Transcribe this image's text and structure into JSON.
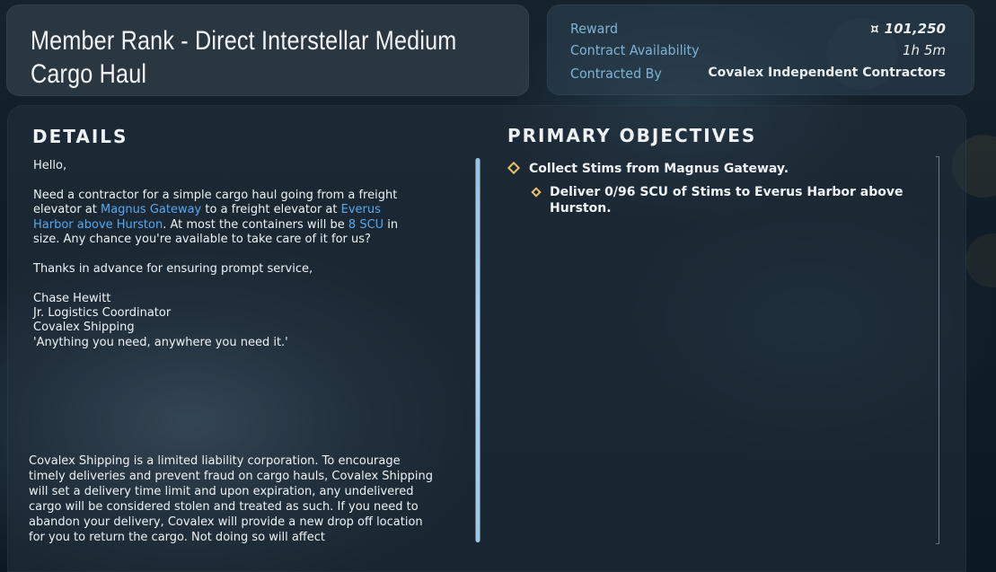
{
  "contract": {
    "title_line1": "Member Rank - Direct Interstellar Medium",
    "title_line2": "Cargo Haul"
  },
  "summary": {
    "reward_label": "Reward",
    "reward_icon": "¤",
    "reward_value": "101,250",
    "availability_label": "Contract Availability",
    "availability_value": "1h 5m",
    "contracted_by_label": "Contracted By",
    "contracted_by_value": "Covalex Independent Contractors"
  },
  "details": {
    "heading": "DETAILS",
    "greeting": "Hello,",
    "p1_a": "Need a contractor for a simple cargo haul going from a freight elevator at ",
    "p1_link1": "Magnus Gateway",
    "p1_b": " to a freight elevator at ",
    "p1_link2": "Everus Harbor above Hurston",
    "p1_c": ". At most the containers will be ",
    "p1_link3": "8 SCU",
    "p1_d": " in size. Any chance you're available to take care of it for us?",
    "thanks": "Thanks in advance for ensuring prompt service,",
    "sig_name": "Chase Hewitt",
    "sig_role": "Jr. Logistics Coordinator",
    "sig_company": "Covalex Shipping",
    "sig_motto": "'Anything you need, anywhere you need it.'",
    "legal": "Covalex Shipping is a limited liability corporation. To encourage timely deliveries and prevent fraud on cargo hauls, Covalex Shipping will set a delivery time limit and upon expiration, any undelivered cargo will be considered stolen and treated as such. If you need to abandon your delivery, Covalex will provide a new drop off location for you to return the cargo. Not doing so will affect"
  },
  "objectives": {
    "heading": "PRIMARY OBJECTIVES",
    "items": [
      {
        "text": "Collect Stims from Magnus Gateway."
      },
      {
        "text": "Deliver 0/96 SCU of Stims to Everus Harbor above Hurston."
      }
    ]
  },
  "colors": {
    "accent_link": "#56a9f0",
    "label_blue": "#7fb3d6",
    "objective_diamond": "#e8c26a"
  }
}
